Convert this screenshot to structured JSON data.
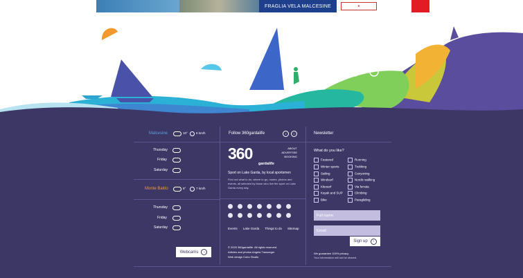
{
  "banner": {
    "title": "FRAGLIA VELA MALCESINE"
  },
  "weather": {
    "location1": "Malcesine",
    "temp1": "10°",
    "wind1": "8 km/h",
    "days1": [
      "Thursday",
      "Friday",
      "Saturday"
    ],
    "location2": "Monte Baldo",
    "temp2": "8°",
    "wind2": "7 km/h",
    "days2": [
      "Thursday",
      "Friday",
      "Saturday"
    ],
    "webcams_label": "Webcams"
  },
  "follow": {
    "title": "Follow 360gardalife",
    "logo_text": "360",
    "logo_sub": "gardalife",
    "menu": [
      "ABOUT",
      "ADVERTISE",
      "BOOKING"
    ],
    "tagline": "Sport on Lake Garda, by local sportsmen",
    "description": "Find out what to do, where to go, routes, photos and events, all selected by those who live the sport on Lake Garda every day.",
    "links": [
      "Events",
      "Lake Garda",
      "Things to do",
      "Sitemap"
    ],
    "copyright": "© 2020 360gardalife. All rights reserved.",
    "credits1": "Articles and photos Angela Trawoeger",
    "credits2": "Web design  Cobo Studio"
  },
  "newsletter": {
    "title": "Newsletter",
    "question": "What do you like?",
    "col1": [
      "Featured",
      "Winter sports",
      "Sailing",
      "Windsurf",
      "Kitesurf",
      "Kayak and SUP",
      "Bike"
    ],
    "col2": [
      "Running",
      "Trekking",
      "Canyoning",
      "Nordic walking",
      "Via ferrata",
      "Climbing",
      "Paragliding"
    ],
    "full_name_placeholder": "Full name",
    "email_placeholder": "Email",
    "signup_label": "Sign up",
    "guarantee": "We guarantee 100% privacy.",
    "guarantee2": "Your information will not be shared."
  },
  "colors": {
    "footer_bg": "#3d3766",
    "accent_orange": "#f29a2e",
    "accent_blue": "#5aa0e0"
  }
}
